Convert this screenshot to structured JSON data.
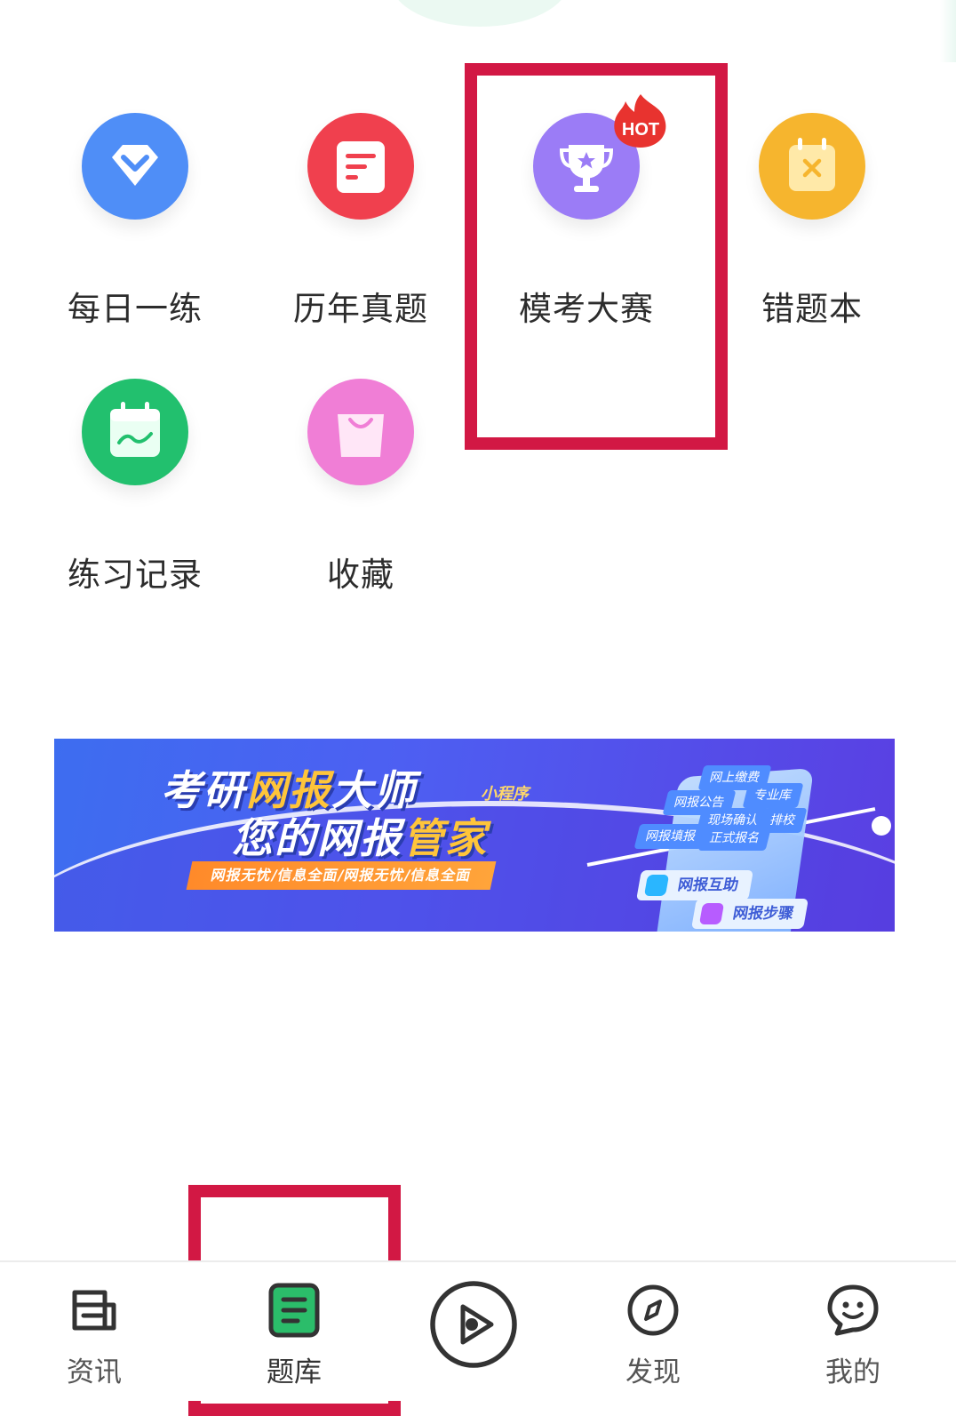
{
  "grid": {
    "items": [
      {
        "label": "每日一练",
        "icon": "diamond-check-icon",
        "color": "#4f8ef7"
      },
      {
        "label": "历年真题",
        "icon": "document-icon",
        "color": "#f0404e"
      },
      {
        "label": "模考大赛",
        "icon": "trophy-icon",
        "color": "#9b7cf6",
        "badge": "HOT"
      },
      {
        "label": "错题本",
        "icon": "calendar-x-icon",
        "color": "#f6b52e"
      },
      {
        "label": "练习记录",
        "icon": "calendar-chart-icon",
        "color": "#22c06e"
      },
      {
        "label": "收藏",
        "icon": "shopping-bag-icon",
        "color": "#f07ed6"
      }
    ]
  },
  "banner": {
    "line1_a": "考研",
    "line1_b": "网报",
    "line1_c": "大师",
    "line2_a": "您的网报",
    "line2_b": "管家",
    "tag": "小程序",
    "strip": "网报无忧/信息全面/网报无忧/信息全面",
    "cards": [
      "网上缴费",
      "网报公告",
      "专业库",
      "现场确认",
      "排校",
      "网报填报",
      "正式报名"
    ],
    "btn1": "网报互助",
    "btn2": "网报步骤"
  },
  "nav": {
    "items": [
      {
        "label": "资讯",
        "icon": "news-icon"
      },
      {
        "label": "题库",
        "icon": "question-bank-icon",
        "active": true
      },
      {
        "label": "",
        "icon": "play-circle-icon"
      },
      {
        "label": "发现",
        "icon": "compass-icon"
      },
      {
        "label": "我的",
        "icon": "smile-chat-icon"
      }
    ]
  },
  "colors": {
    "highlight": "#d21844",
    "active": "#2bbd6a"
  }
}
